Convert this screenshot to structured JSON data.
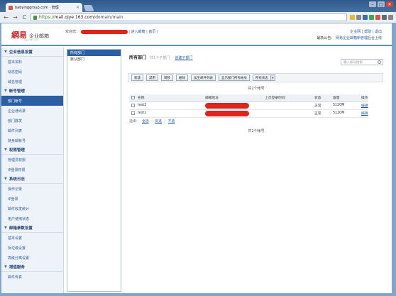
{
  "browser": {
    "tab_title": "babyinggroup.com · 管理",
    "tab_close": "×",
    "new_tab": "",
    "url_scheme": "https://",
    "url_host": "mail.qiye.163.com",
    "url_path": "/domain/main",
    "nav_back": "←",
    "nav_forward": "→",
    "nav_reload": "C",
    "win_min": "–",
    "win_max": "□",
    "win_close": "✕",
    "ext_colors": [
      "#e8b830",
      "#8a8a8a",
      "#3a6ea5",
      "#3cae3c",
      "#d9534f",
      "#6a6a6a",
      "#888888"
    ]
  },
  "header": {
    "logo_brand": "網易",
    "logo_sub": "企业邮箱",
    "logo_tiny": "qiye.163.com",
    "welcome_prefix": "欢迎您：",
    "welcome_links": [
      "进入邮箱",
      "首页"
    ],
    "top_links": [
      "企业网",
      "帮助",
      "退出"
    ],
    "notice_label": "最新公告：",
    "notice_link": "网易企业邮箱新管理后台上线"
  },
  "sidebar": {
    "sections": [
      {
        "title": "企业信息设置",
        "items": [
          "基本资料",
          "动态密码",
          "域名管理"
        ]
      },
      {
        "title": "帐号管理",
        "items": [
          "部门帐号",
          "企业通讯录",
          "部门群发",
          "邮件列表",
          "随身邮帐号"
        ]
      },
      {
        "title": "权限管理",
        "items": [
          "管理员权限",
          "IP登录权限"
        ]
      },
      {
        "title": "系统日志",
        "items": [
          "操作记录",
          "IP登录",
          "邮件收发统计",
          "用户使用状态"
        ]
      },
      {
        "title": "邮箱参数设置",
        "items": [
          "基本设置",
          "反垃圾设置",
          "高级分离设置"
        ]
      },
      {
        "title": "增值服务",
        "items": [
          "邮件传真"
        ]
      }
    ],
    "active": "部门帐号"
  },
  "departments": [
    "所有部门",
    "默认部门"
  ],
  "main": {
    "title": "所有部门",
    "count": "共1个子部门",
    "create_dept": "创建子部门",
    "search_placeholder": "输入帐号搜索",
    "buttons": [
      "新建",
      "禁用",
      "转移",
      "删除",
      "加至邮件列表",
      "显示部门所有帐号",
      "所有状态"
    ],
    "dropdown_arrow": "▾",
    "total_top": "共2个帐号",
    "total_bottom": "共2个帐号",
    "columns": [
      "名称",
      "邮箱地址",
      "上次登录时间",
      "状态",
      "容量",
      "操作"
    ],
    "rows": [
      {
        "name": "test2",
        "status": "正常",
        "capacity": "5120M",
        "action": "编辑"
      },
      {
        "name": "test1",
        "status": "正常",
        "capacity": "5120M",
        "action": "编辑"
      }
    ],
    "select_label": "选择：",
    "select_links": [
      "全选",
      "反选",
      "不选"
    ]
  }
}
